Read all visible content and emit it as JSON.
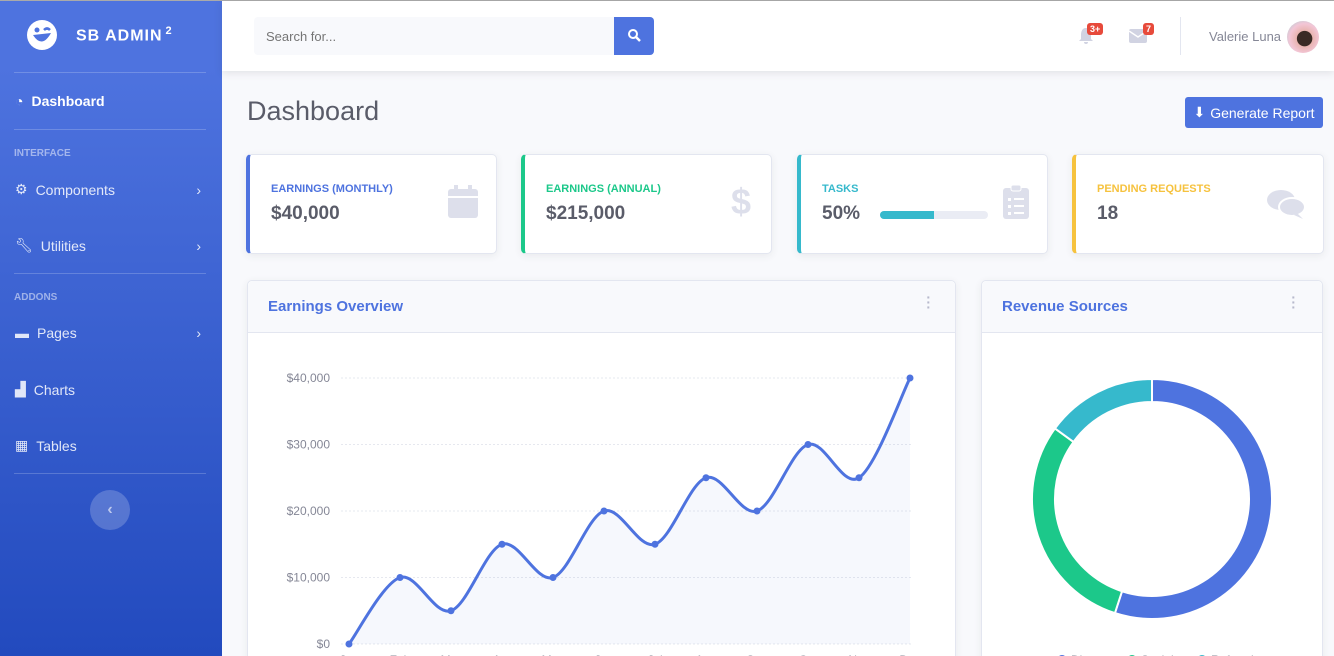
{
  "sidebar": {
    "brand": "SB ADMIN",
    "brand_sup": "2",
    "items": [
      {
        "label": "Dashboard"
      },
      {
        "label": "Components"
      },
      {
        "label": "Utilities"
      },
      {
        "label": "Pages"
      },
      {
        "label": "Charts"
      },
      {
        "label": "Tables"
      }
    ],
    "headings": [
      "INTERFACE",
      "ADDONS"
    ]
  },
  "topbar": {
    "search_placeholder": "Search for...",
    "alerts_badge": "3+",
    "messages_badge": "7",
    "user_name": "Valerie Luna"
  },
  "page": {
    "title": "Dashboard",
    "generate_report": "Generate Report"
  },
  "stats": [
    {
      "label": "EARNINGS (MONTHLY)",
      "value": "$40,000",
      "color": "#4e73df",
      "icon": "calendar-icon"
    },
    {
      "label": "EARNINGS (ANNUAL)",
      "value": "$215,000",
      "color": "#1cc88a",
      "icon": "dollar-icon"
    },
    {
      "label": "TASKS",
      "value": "50%",
      "color": "#36b9cc",
      "icon": "clipboard-list-icon",
      "progress": 50
    },
    {
      "label": "PENDING REQUESTS",
      "value": "18",
      "color": "#f6c23e",
      "icon": "comments-icon"
    }
  ],
  "earnings_card": {
    "title": "Earnings Overview"
  },
  "revenue_card": {
    "title": "Revenue Sources"
  },
  "chart_data": [
    {
      "type": "line",
      "categories": [
        "Jan",
        "Feb",
        "Mar",
        "Apr",
        "May",
        "Jun",
        "Jul",
        "Aug",
        "Sep",
        "Oct",
        "Nov",
        "Dec"
      ],
      "values": [
        0,
        10000,
        5000,
        15000,
        10000,
        20000,
        15000,
        25000,
        20000,
        30000,
        25000,
        40000
      ],
      "yticks": [
        "$0",
        "$10,000",
        "$20,000",
        "$30,000",
        "$40,000"
      ],
      "ylim": [
        0,
        40000
      ],
      "grid": true,
      "color": "#4e73df"
    },
    {
      "type": "pie",
      "donut": true,
      "labels": [
        "Direct",
        "Social",
        "Referral"
      ],
      "values": [
        55,
        30,
        15
      ],
      "colors": [
        "#4e73df",
        "#1cc88a",
        "#36b9cc"
      ],
      "legend": "bottom"
    }
  ]
}
